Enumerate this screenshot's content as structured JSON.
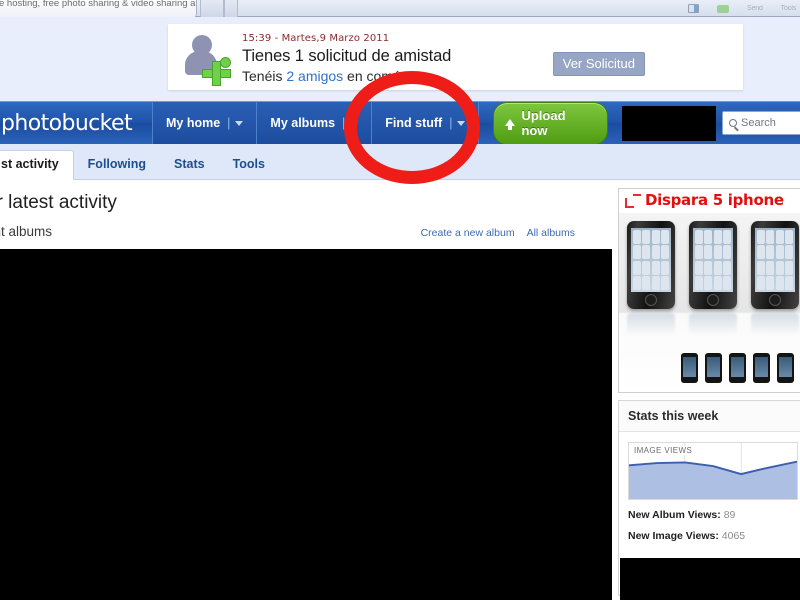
{
  "browser": {
    "tab_title": "e hosting, free photo sharing & video sharing at ...",
    "toolbar_icons": [
      "monitor-icon",
      "chat-icon"
    ],
    "toolbar_labels": [
      "Send",
      "Tools"
    ]
  },
  "notification": {
    "timestamp": "15:39 - Martes,9 Marzo 2011",
    "heading": "Tienes 1 solicitud de amistad",
    "sub_prefix": "Tenéis ",
    "sub_link": "2 amigos",
    "sub_suffix": " en común",
    "button_label": "Ver Solicitud",
    "avatar_icon": "friend-request-avatar-icon"
  },
  "nav": {
    "logo": "photobucket",
    "items": [
      {
        "label": "My home",
        "sep": "|",
        "caret": "chevron-down-icon"
      },
      {
        "label": "My albums",
        "sep": "|",
        "caret": "chevron-down-icon"
      },
      {
        "label": "Find stuff",
        "sep": "|",
        "caret": "chevron-down-icon"
      }
    ],
    "upload_label": "Upload now",
    "upload_icon": "upload-arrow-icon",
    "search_placeholder": "Search",
    "search_icon": "search-icon"
  },
  "tabs": [
    {
      "label": "st activity",
      "active": true
    },
    {
      "label": "Following",
      "active": false
    },
    {
      "label": "Stats",
      "active": false
    },
    {
      "label": "Tools",
      "active": false
    }
  ],
  "main": {
    "heading": "ur latest activity",
    "subheading": "ent albums",
    "links": [
      "Create a new album",
      "All albums"
    ]
  },
  "sidebar": {
    "ad": {
      "title": "Dispara 5 iphone",
      "corner_icon": "ad-corner-icon"
    },
    "stats": {
      "header": "Stats this week",
      "chart_label": "IMAGE VIEWS",
      "album_views_label": "New Album Views:",
      "album_views_value": "89",
      "image_views_label": "New Image Views:",
      "image_views_value": "4065"
    }
  },
  "annotation": {
    "shape": "red-circle-highlight",
    "color": "#ee1d17",
    "target": "upload-now-button"
  },
  "chart_data": {
    "type": "area",
    "title": "IMAGE VIEWS",
    "x": [
      0,
      1,
      2,
      3,
      4,
      5,
      6
    ],
    "values": [
      76,
      82,
      84,
      74,
      52,
      70,
      86
    ],
    "ylim": [
      0,
      100
    ],
    "xlabel": "",
    "ylabel": "",
    "grid": true,
    "legend": "none",
    "line_color": "#3c5fae",
    "fill_color": "#aebfe4"
  }
}
